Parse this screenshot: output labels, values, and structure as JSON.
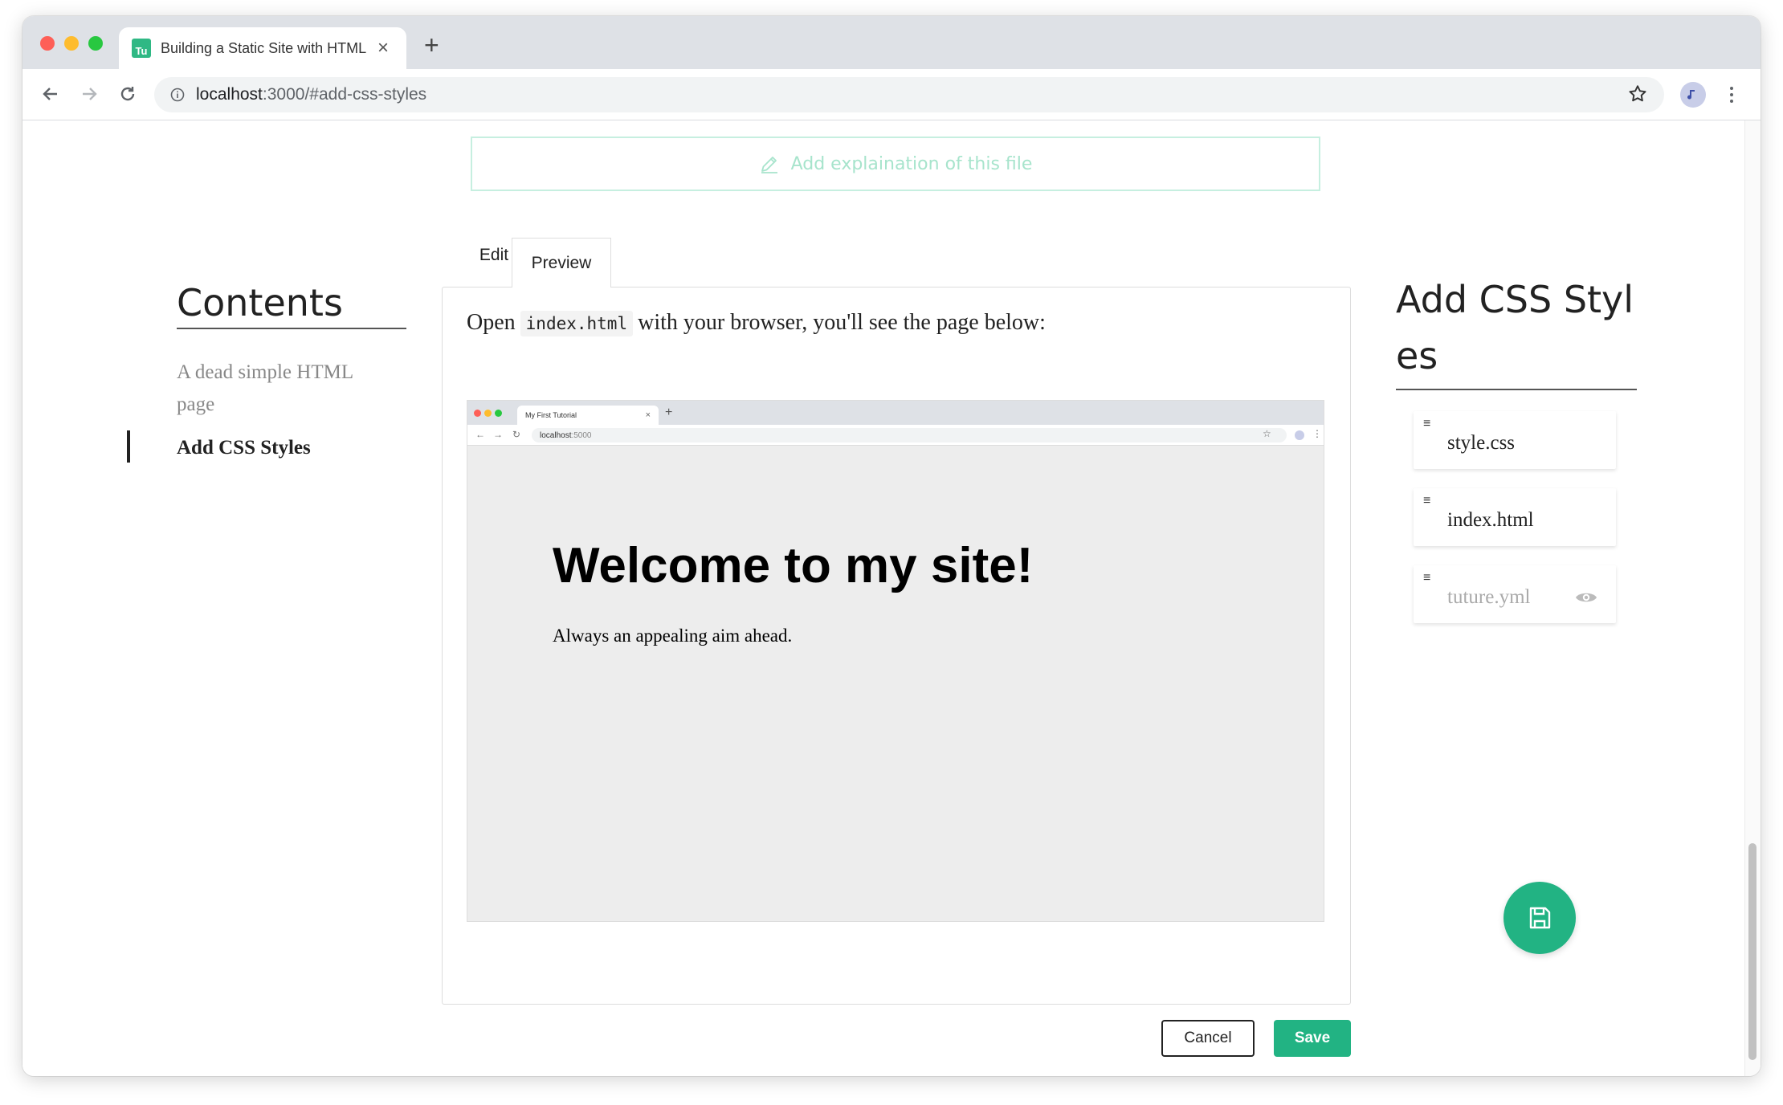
{
  "browser": {
    "tab_title": "Building a Static Site with HTML",
    "favicon_text": "Tu",
    "url_host": "localhost",
    "url_path": ":3000/#add-css-styles"
  },
  "editor": {
    "explain_placeholder": "Add explaination of this file",
    "tabs": {
      "edit": "Edit",
      "preview": "Preview"
    },
    "intro_before": "Open",
    "intro_code": "index.html",
    "intro_after": "with your browser, you'll see the page below:",
    "cancel_label": "Cancel",
    "save_label": "Save"
  },
  "preview_shot": {
    "tab_title": "My First Tutorial",
    "url_host": "localhost",
    "url_path": ":5000",
    "heading": "Welcome to my site!",
    "paragraph": "Always an appealing aim ahead."
  },
  "toc": {
    "title": "Contents",
    "items": [
      {
        "label": "A dead simple HTML page",
        "active": false
      },
      {
        "label": "Add CSS Styles",
        "active": true
      }
    ]
  },
  "step": {
    "title": "Add CSS Styles",
    "files": [
      {
        "name": "style.css",
        "muted": false
      },
      {
        "name": "index.html",
        "muted": false
      },
      {
        "name": "tuture.yml",
        "muted": true
      }
    ]
  },
  "colors": {
    "accent": "#22b383",
    "placeholder": "#a7e4cc",
    "tab_strip": "#dee1e6",
    "preview_bg": "#ededed"
  },
  "icons": {
    "back": "arrow-left-icon",
    "forward": "arrow-right-icon",
    "reload": "reload-icon",
    "info": "info-icon",
    "bookmark": "star-icon",
    "profile": "avatar-icon",
    "menu": "more-vertical-icon",
    "pencil": "pencil-icon",
    "grip": "drag-handle-icon",
    "visibility": "eye-icon",
    "save_fab": "floppy-disk-icon"
  }
}
